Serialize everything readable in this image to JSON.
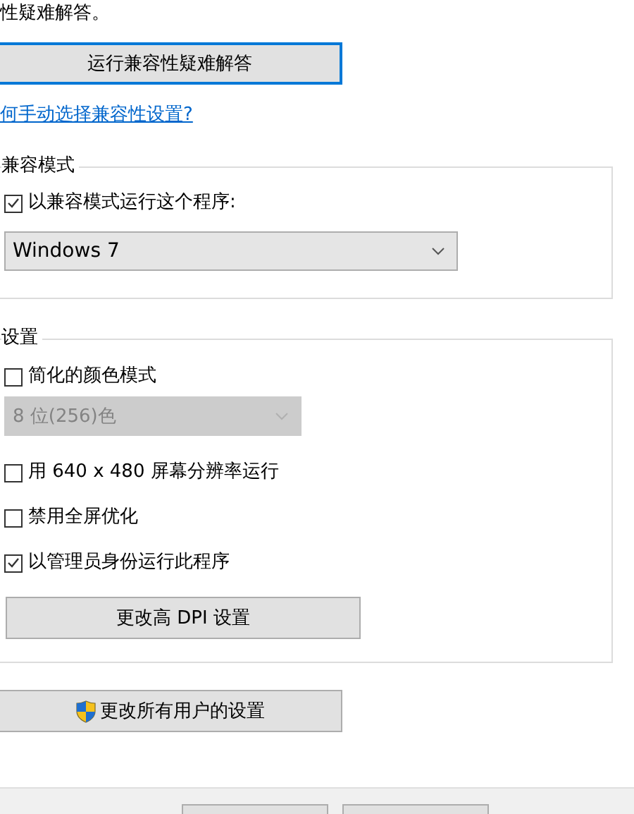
{
  "intro_text": "性疑难解答。",
  "troubleshooter_button": "运行兼容性疑难解答",
  "help_link": "何手动选择兼容性设置?",
  "compatibility_mode": {
    "title": "兼容模式",
    "checkbox": {
      "label": "以兼容模式运行这个程序:",
      "checked": true
    },
    "dropdown": {
      "value": "Windows 7",
      "disabled": false
    }
  },
  "settings": {
    "title": "设置",
    "items": [
      {
        "kind": "checkbox",
        "label": "简化的颜色模式",
        "checked": false
      },
      {
        "kind": "dropdown",
        "value": "8 位(256)色",
        "disabled": true
      },
      {
        "kind": "checkbox",
        "label": "用 640 x 480 屏幕分辨率运行",
        "checked": false
      },
      {
        "kind": "checkbox",
        "label": "禁用全屏优化",
        "checked": false
      },
      {
        "kind": "checkbox",
        "label": "以管理员身份运行此程序",
        "checked": true
      },
      {
        "kind": "button",
        "label": "更改高 DPI 设置"
      }
    ]
  },
  "all_users_button": "更改所有用户的设置"
}
